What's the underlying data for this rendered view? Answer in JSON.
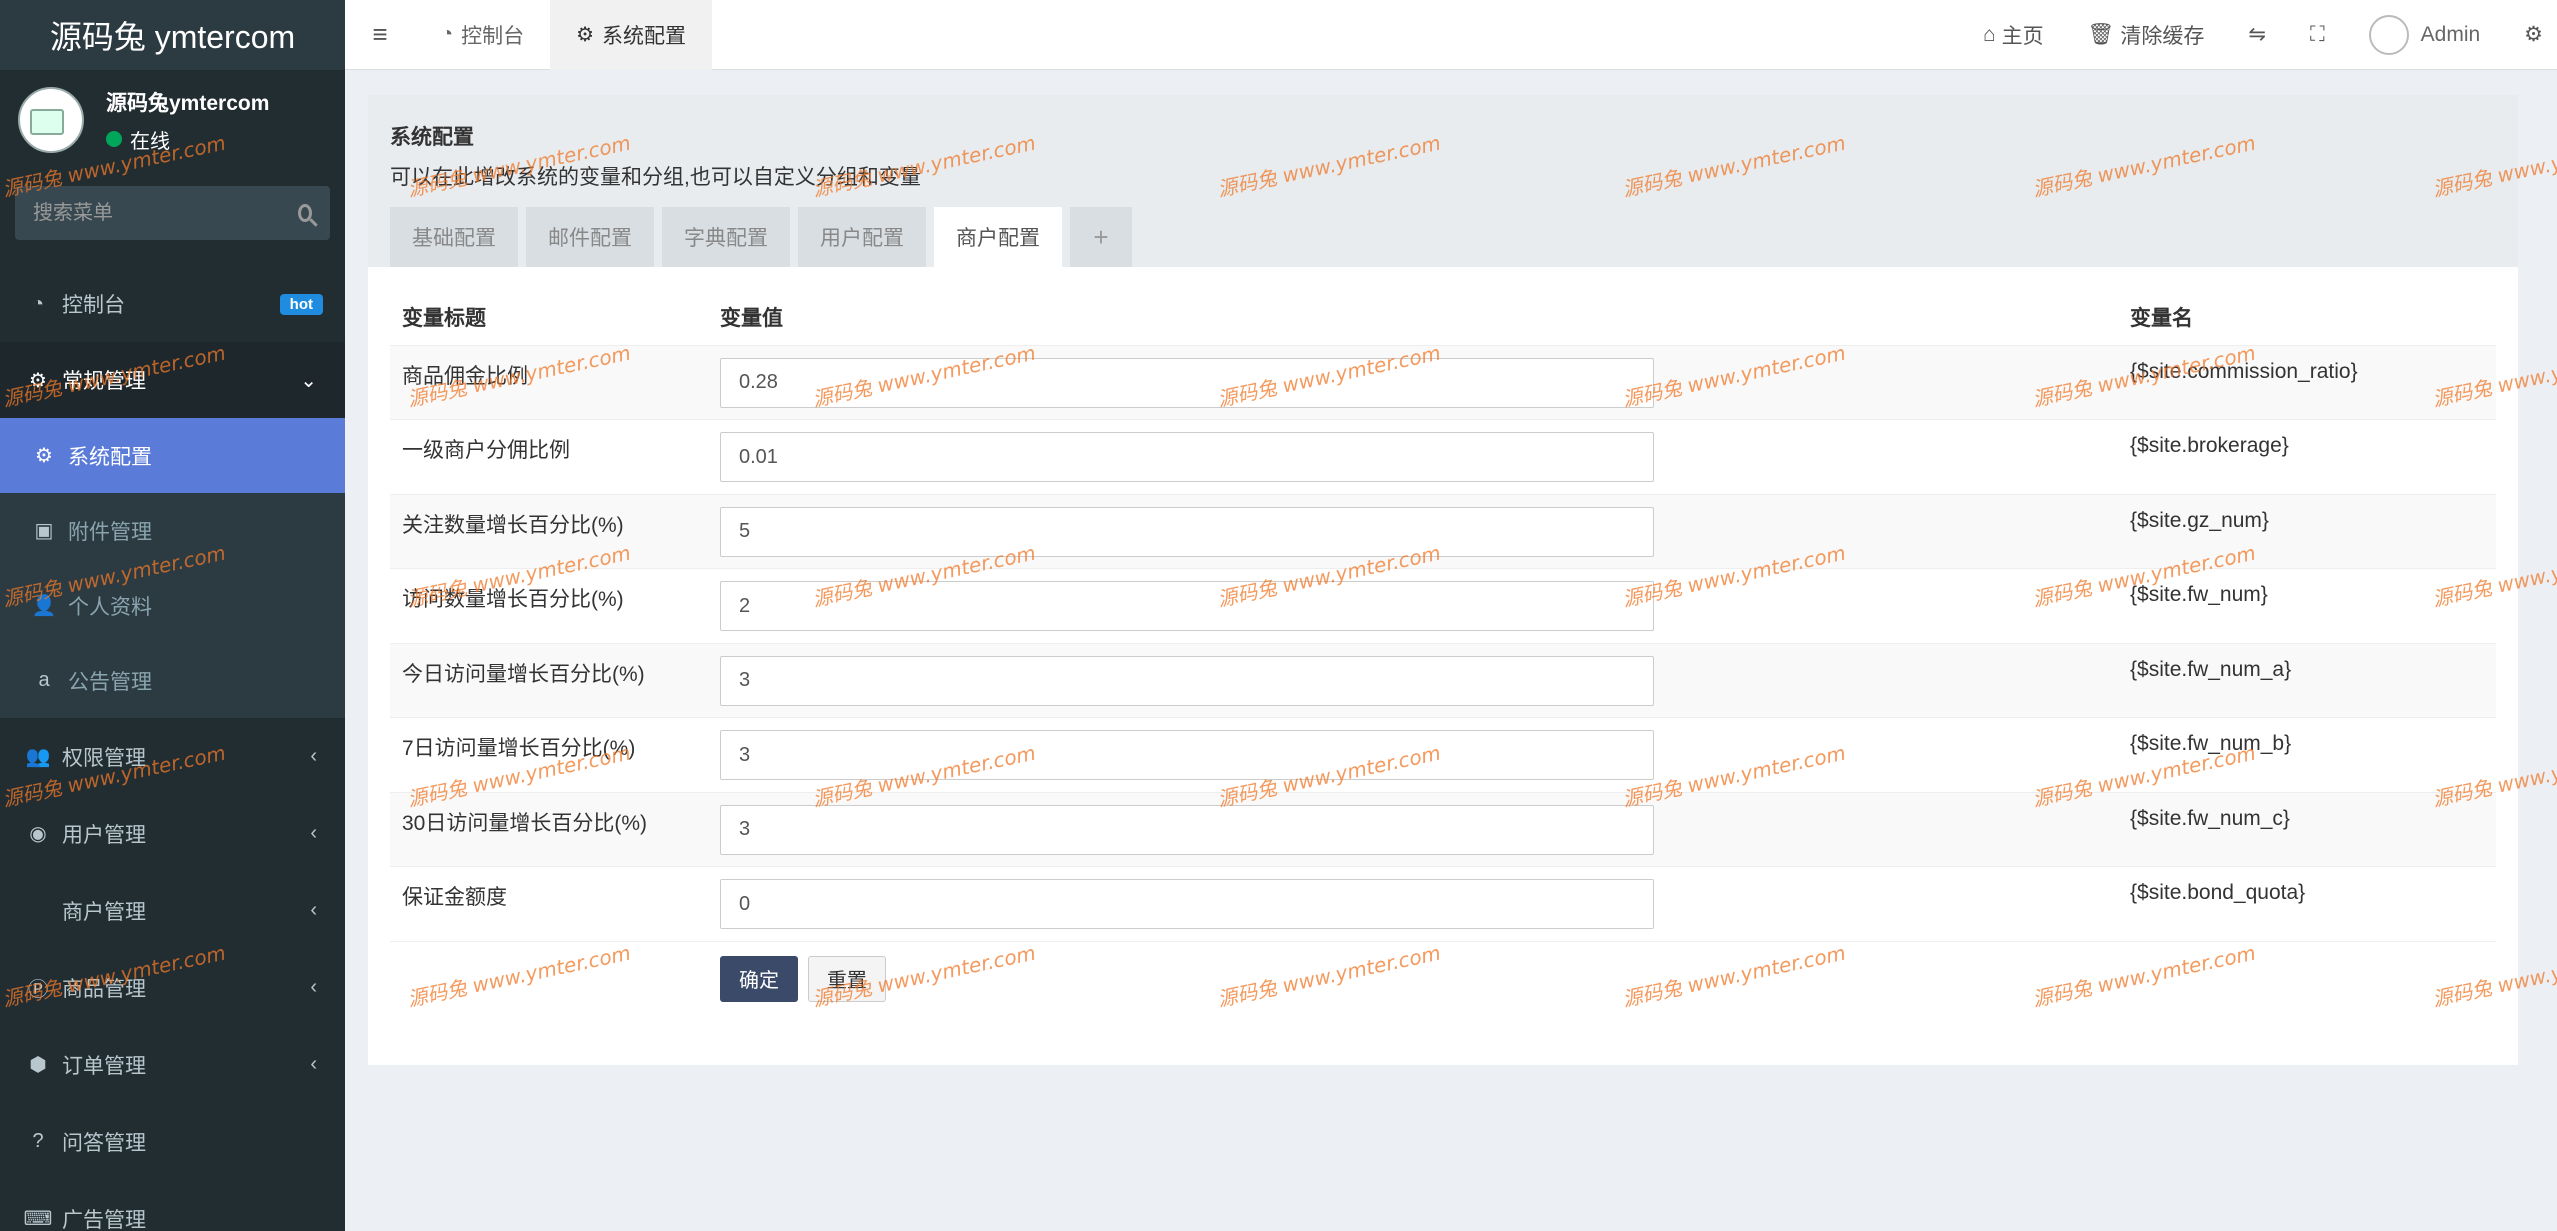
{
  "app": {
    "logo": "源码兔 ymtercom"
  },
  "user_panel": {
    "name": "源码兔ymtercom",
    "status": "在线"
  },
  "search": {
    "placeholder": "搜索菜单"
  },
  "sidebar": {
    "items": [
      {
        "label": "控制台",
        "icon": "dashboard-icon",
        "badge": "hot"
      },
      {
        "label": "常规管理",
        "icon": "cogs-icon",
        "open": true,
        "children": [
          {
            "label": "系统配置",
            "icon": "gear-icon",
            "active": true
          },
          {
            "label": "附件管理",
            "icon": "image-icon"
          },
          {
            "label": "个人资料",
            "icon": "user-icon"
          },
          {
            "label": "公告管理",
            "icon": "amazon-icon"
          }
        ]
      },
      {
        "label": "权限管理",
        "icon": "group-icon"
      },
      {
        "label": "用户管理",
        "icon": "user-circle-icon"
      },
      {
        "label": "商户管理",
        "icon": "apple-icon"
      },
      {
        "label": "商品管理",
        "icon": "product-icon"
      },
      {
        "label": "订单管理",
        "icon": "cube-icon"
      },
      {
        "label": "问答管理",
        "icon": "question-icon"
      },
      {
        "label": "广告管理",
        "icon": "keyboard-icon"
      }
    ]
  },
  "header": {
    "tabs": [
      {
        "label": "控制台"
      },
      {
        "label": "系统配置"
      }
    ],
    "right": {
      "home": "主页",
      "clear_cache": "清除缓存",
      "admin": "Admin"
    }
  },
  "panel": {
    "title": "系统配置",
    "description": "可以在此增改系统的变量和分组,也可以自定义分组和变量",
    "tabs": [
      "基础配置",
      "邮件配置",
      "字典配置",
      "用户配置",
      "商户配置"
    ],
    "add_tab": "+"
  },
  "table": {
    "headers": [
      "变量标题",
      "变量值",
      "变量名"
    ],
    "rows": [
      {
        "title": "商品佣金比例",
        "value": "0.28",
        "name": "{$site.commission_ratio}"
      },
      {
        "title": "一级商户分佣比例",
        "value": "0.01",
        "name": "{$site.brokerage}"
      },
      {
        "title": "关注数量增长百分比(%)",
        "value": "5",
        "name": "{$site.gz_num}"
      },
      {
        "title": "访问数量增长百分比(%)",
        "value": "2",
        "name": "{$site.fw_num}"
      },
      {
        "title": "今日访问量增长百分比(%)",
        "value": "3",
        "name": "{$site.fw_num_a}"
      },
      {
        "title": "7日访问量增长百分比(%)",
        "value": "3",
        "name": "{$site.fw_num_b}"
      },
      {
        "title": "30日访问量增长百分比(%)",
        "value": "3",
        "name": "{$site.fw_num_c}"
      },
      {
        "title": "保证金额度",
        "value": "0",
        "name": "{$site.bond_quota}"
      }
    ],
    "confirm": "确定",
    "reset": "重置"
  },
  "watermark": "源码兔  www.ymter.com",
  "colors": {
    "sidebar": "#222d32",
    "active": "#5b7bd9",
    "primary_btn": "#3b4a69",
    "online": "#00a65a"
  }
}
